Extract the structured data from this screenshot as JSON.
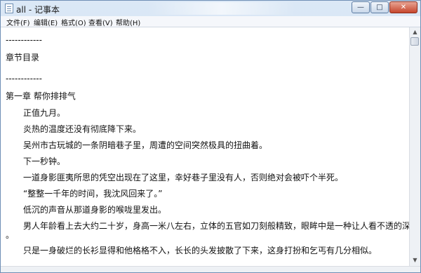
{
  "window": {
    "title": "all - 记事本",
    "controls": {
      "minimize": "—",
      "maximize": "□",
      "close": "✕"
    }
  },
  "menu": [
    {
      "label": "文件(F)"
    },
    {
      "label": "编辑(E)"
    },
    {
      "label": "格式(O)"
    },
    {
      "label": "查看(V)"
    },
    {
      "label": "帮助(H)"
    }
  ],
  "document": {
    "lines": [
      "------------",
      "章节目录",
      "------------",
      "第一章 帮你排排气",
      "正值九月。",
      "炎热的温度还没有彻底降下来。",
      "吴州市古玩城的一条阴暗巷子里，周遭的空间突然极具的扭曲着。",
      "下一秒钟。",
      "一道身影匪夷所思的凭空出现在了这里，幸好巷子里没有人，否则绝对会被吓个半死。",
      "“整整一千年的时间，我沈风回来了。”",
      "低沉的声音从那道身影的喉咙里发出。",
      "男人年龄看上去大约二十岁，身高一米八左右，立体的五官如刀刻般精致，眼眸中是一种让人看不透的深邃",
      "。",
      "只是一身破烂的长衫显得和他格格不入，长长的头发披散了下来，这身打扮和乞丐有几分相似。"
    ]
  },
  "scrollbar": {
    "up": "▲",
    "down": "▼"
  }
}
